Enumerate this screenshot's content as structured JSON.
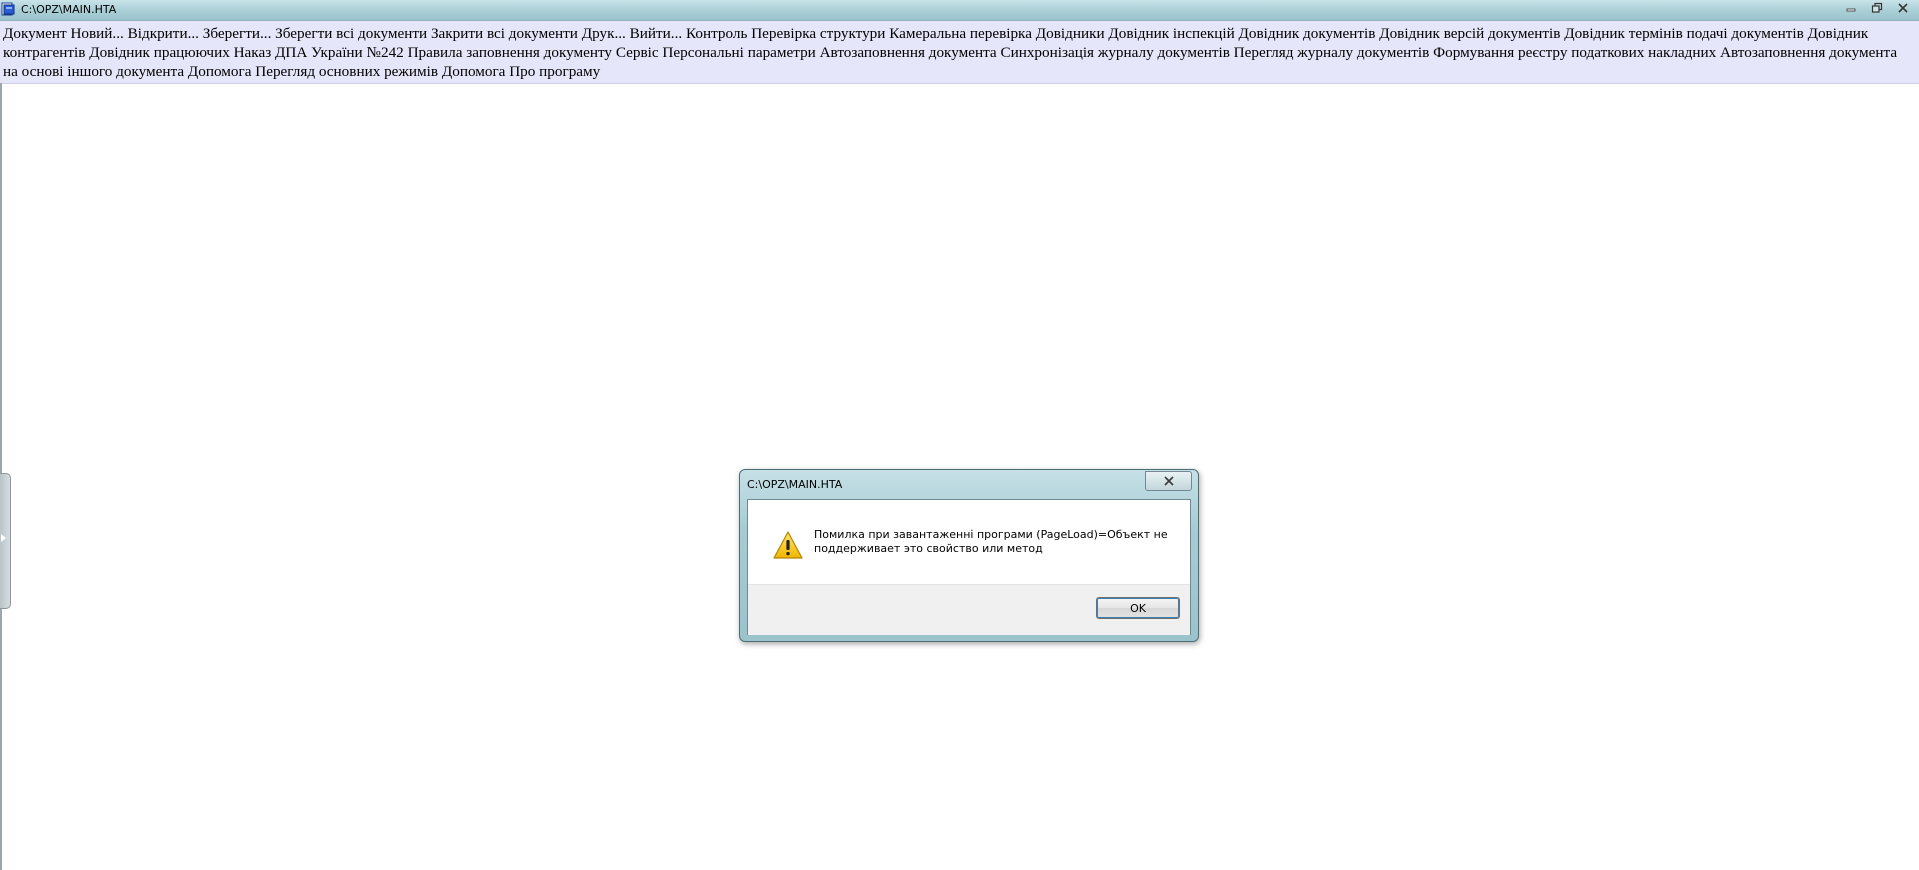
{
  "window": {
    "title": "C:\\OPZ\\MAIN.HTA",
    "controls": [
      "minimize-icon",
      "restore-icon",
      "close-icon"
    ]
  },
  "menu": {
    "items": [
      "Документ",
      "Новий...",
      "Відкрити...",
      "Зберегти...",
      "Зберегти всі документи",
      "Закрити всі документи",
      "Друк...",
      "Вийти...",
      "Контроль",
      "Перевірка структури",
      "Камеральна перевірка",
      "Довідники",
      "Довідник інспекцій",
      "Довідник документів",
      "Довідник версій документів",
      "Довідник термінів подачі документів",
      "Довідник контрагентів",
      "Довідник працюючих",
      "Наказ ДПА України №242",
      "Правила заповнення документу",
      "Сервіс",
      "Персональні параметри",
      "Автозаповнення документа",
      "Синхронізація журналу документів",
      "Перегляд журналу документів",
      "Формування реєстру податкових накладних",
      "Автозаповнення документа на основі іншого документа",
      "Допомога",
      "Перегляд основних режимів",
      "Допомога",
      "Про програму"
    ]
  },
  "dialog": {
    "title": "C:\\OPZ\\MAIN.HTA",
    "message": "Помилка при завантаженні програми (PageLoad)=Объект не поддерживает это свойство или метод",
    "ok_label": "OK",
    "icon": "warning-icon"
  },
  "colors": {
    "titlebar": "#a9ced6",
    "menu_background": "#e6e6fa",
    "dialog_footer": "#f0f0f0",
    "warning": "#f5c400"
  }
}
